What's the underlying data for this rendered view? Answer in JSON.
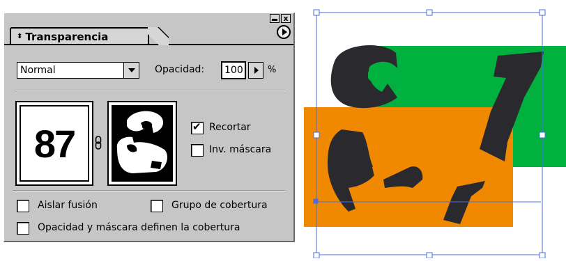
{
  "panel": {
    "tab_label": "Transparencia",
    "tab_arrows": "⬍",
    "minimize_icon": "minimize-icon",
    "close_glyph": "x",
    "blend_mode": "Normal",
    "opacity_label": "Opacidad:",
    "opacity_value": "100",
    "percent_sign": "%",
    "art_thumb_text": "87",
    "clip_label": "Recortar",
    "clip_checked": true,
    "invert_label": "Inv. máscara",
    "invert_checked": false,
    "isolate_label": "Aislar fusión",
    "knockout_label": "Grupo de cobertura",
    "opacity_mask_label": "Opacidad y máscara definen la cobertura"
  },
  "colors": {
    "green": "#00b140",
    "orange": "#f08800",
    "glyph": "#2a2a2e",
    "selection": "#4a6ee0"
  }
}
